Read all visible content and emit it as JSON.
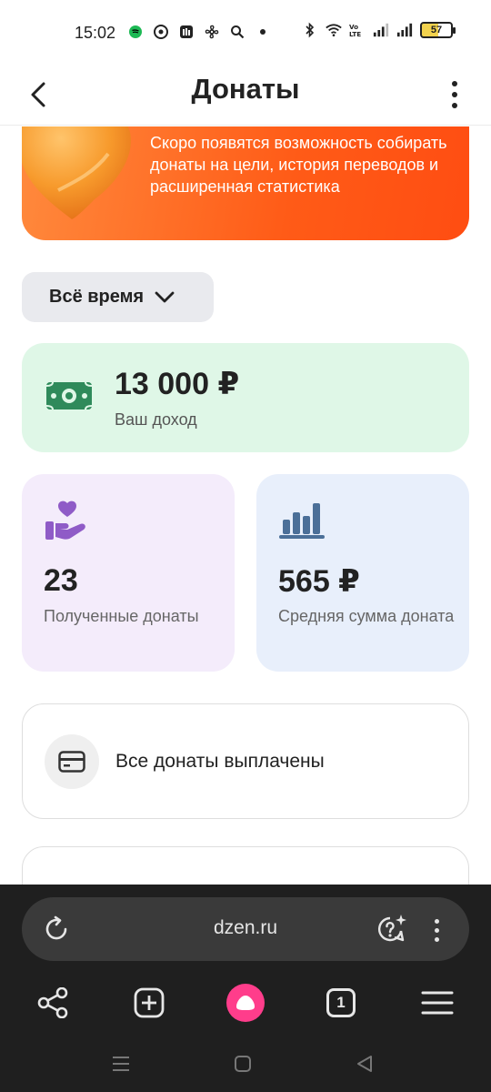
{
  "status_bar": {
    "time": "15:02",
    "battery": "57"
  },
  "header": {
    "title": "Донаты"
  },
  "banner": {
    "text": "Скоро появятся возможность собирать донаты на цели, история переводов и расширенная статистика"
  },
  "filter": {
    "label": "Всё время"
  },
  "income": {
    "amount": "13 000 ₽",
    "label": "Ваш доход"
  },
  "stats": [
    {
      "value": "23",
      "label": "Полученные донаты",
      "icon": "heart-hand-icon",
      "color": "#f4ecfb"
    },
    {
      "value": "565 ₽",
      "label": "Средняя сумма доната",
      "icon": "bar-chart-icon",
      "color": "#e8effb"
    }
  ],
  "payout": {
    "label": "Все донаты выплачены",
    "icon": "card-icon"
  },
  "browser": {
    "url": "dzen.ru",
    "tabs_count": "1"
  },
  "colors": {
    "banner_orange": "#ff5b17",
    "income_green": "#dff7e7",
    "money_icon": "#2f8a5b",
    "purple_icon": "#8f5bc7",
    "blue_icon": "#4b6f98",
    "alice_pink": "#ff3d8b"
  }
}
